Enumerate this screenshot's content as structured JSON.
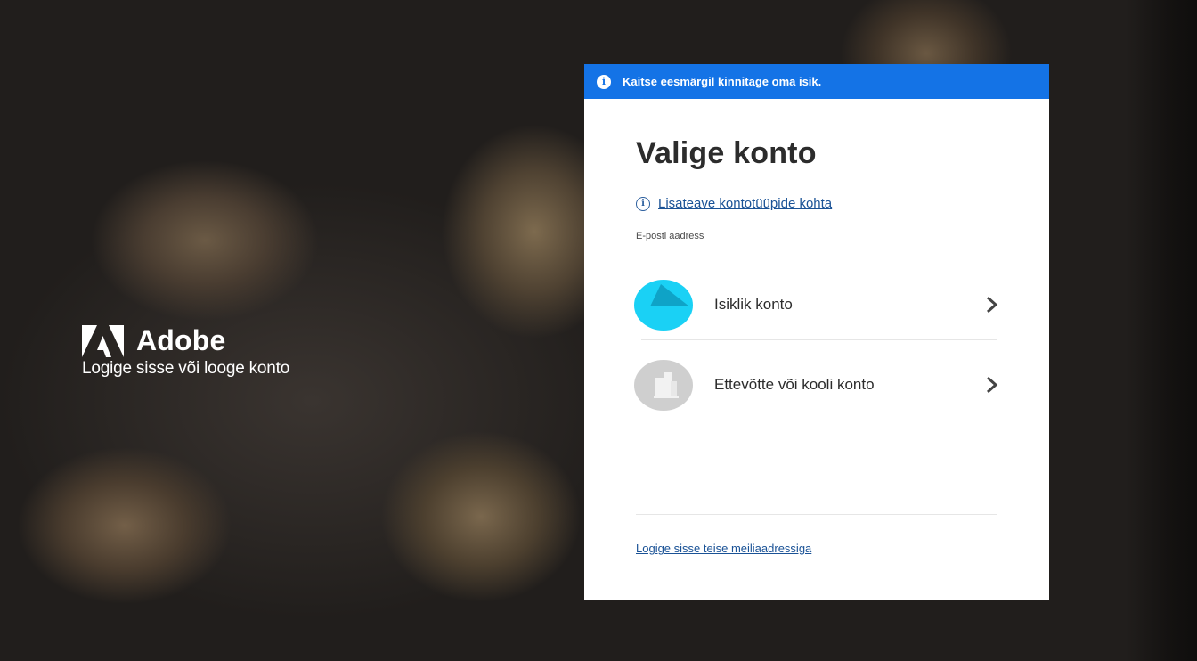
{
  "banner": {
    "icon": "info-icon",
    "text": "Kaitse eesmärgil kinnitage oma isik.",
    "color": "#1473e6"
  },
  "brand": {
    "name": "Adobe",
    "tagline": "Logige sisse või looge konto",
    "logo_icon": "adobe-logo-icon"
  },
  "dialog": {
    "title": "Valige konto",
    "learn_more_link": "Lisateave kontotüüpide kohta",
    "email_label": "E-posti aadress",
    "accounts": [
      {
        "label": "Isiklik konto",
        "icon": "personal-account-icon",
        "color": "#1ad1f5"
      },
      {
        "label": "Ettevõtte või kooli konto",
        "icon": "business-account-icon",
        "color": "#cfcfcf"
      }
    ],
    "other_email_link": "Logige sisse teise meiliaadressiga"
  }
}
